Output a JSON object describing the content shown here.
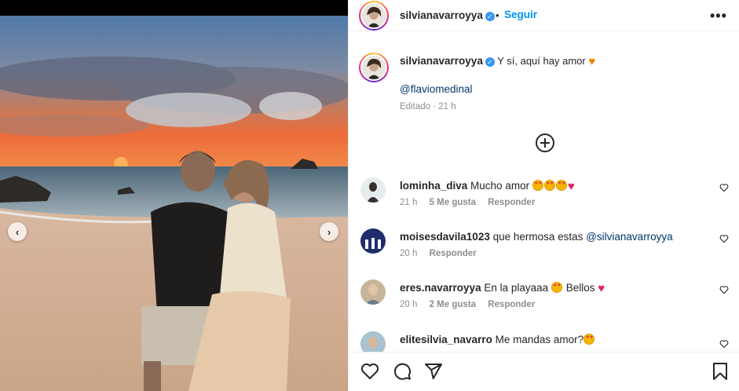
{
  "post": {
    "username": "silvianavarroyya",
    "follow_label": "Seguir",
    "more_label": "•••",
    "separator": "•",
    "caption_text": "Y sí, aquí hay amor",
    "caption_emoji": "♥",
    "mention": "@flaviomedinal",
    "edited": "Editado · 21 h"
  },
  "comments": [
    {
      "user": "lominha_diva",
      "text": "Mucho amor",
      "emojis": 3,
      "heart": "♥",
      "time": "21 h",
      "likes": "5 Me gusta",
      "reply": "Responder",
      "avatar_color": "#cfd6dc"
    },
    {
      "user": "moisesdavila1023",
      "text": "que hermosa estas",
      "mention": "@silvianavarroyya",
      "time": "20 h",
      "reply": "Responder",
      "avatar_color": "#2a3a7a"
    },
    {
      "user": "eres.navarroyya",
      "text": "En la playaaa",
      "after": "Bellos",
      "heart": "♥",
      "time": "20 h",
      "likes": "2 Me gusta",
      "reply": "Responder",
      "avatar_color": "#b9a58c"
    },
    {
      "user": "elitesilvia_navarro",
      "text": "Me mandas amor?",
      "avatar_color": "#9ab2c0"
    }
  ],
  "icons": {
    "prev": "‹",
    "next": "›"
  },
  "colors": {
    "accent": "#0095f6",
    "verified": "#3897f0",
    "mention": "#00376b"
  }
}
